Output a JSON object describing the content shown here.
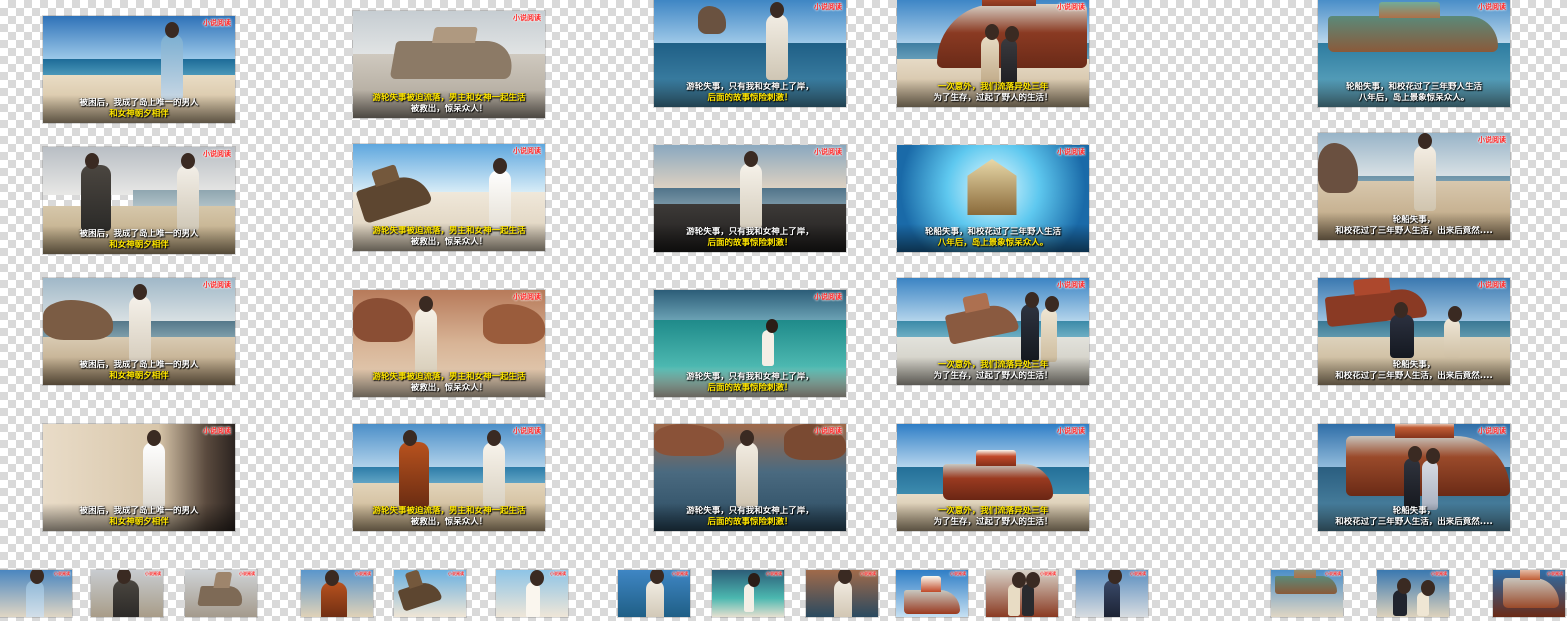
{
  "badge_text": "小说阅读",
  "captions": {
    "c1": [
      "被困后，我成了岛上唯一的男人",
      "和女神朝夕相伴"
    ],
    "c2": [
      "游轮失事被迫流落，男主和女神一起生活",
      "被救出，惊呆众人！"
    ],
    "c3": [
      "游轮失事，只有我和女神上了岸，",
      "后面的故事惊险刺激！"
    ],
    "c4a": [
      "一次意外，我们流落异处三年",
      "为了生存，过起了野人的生活！"
    ],
    "c4b": [
      "轮船失事，和校花过了三年野人生活",
      "八年后，岛上景象惊呆众人。"
    ],
    "c5a": [
      "轮船失事，和校花过了三年野人生活",
      "八年后，岛上景象惊呆众人。"
    ],
    "c5b": [
      "轮船失事，",
      "和校花过了三年野人生活，出来后竟然...."
    ]
  },
  "colors": {
    "caption_highlight": "#ffe600",
    "badge": "#ff2a2a",
    "checker": "#d9d9d9"
  }
}
